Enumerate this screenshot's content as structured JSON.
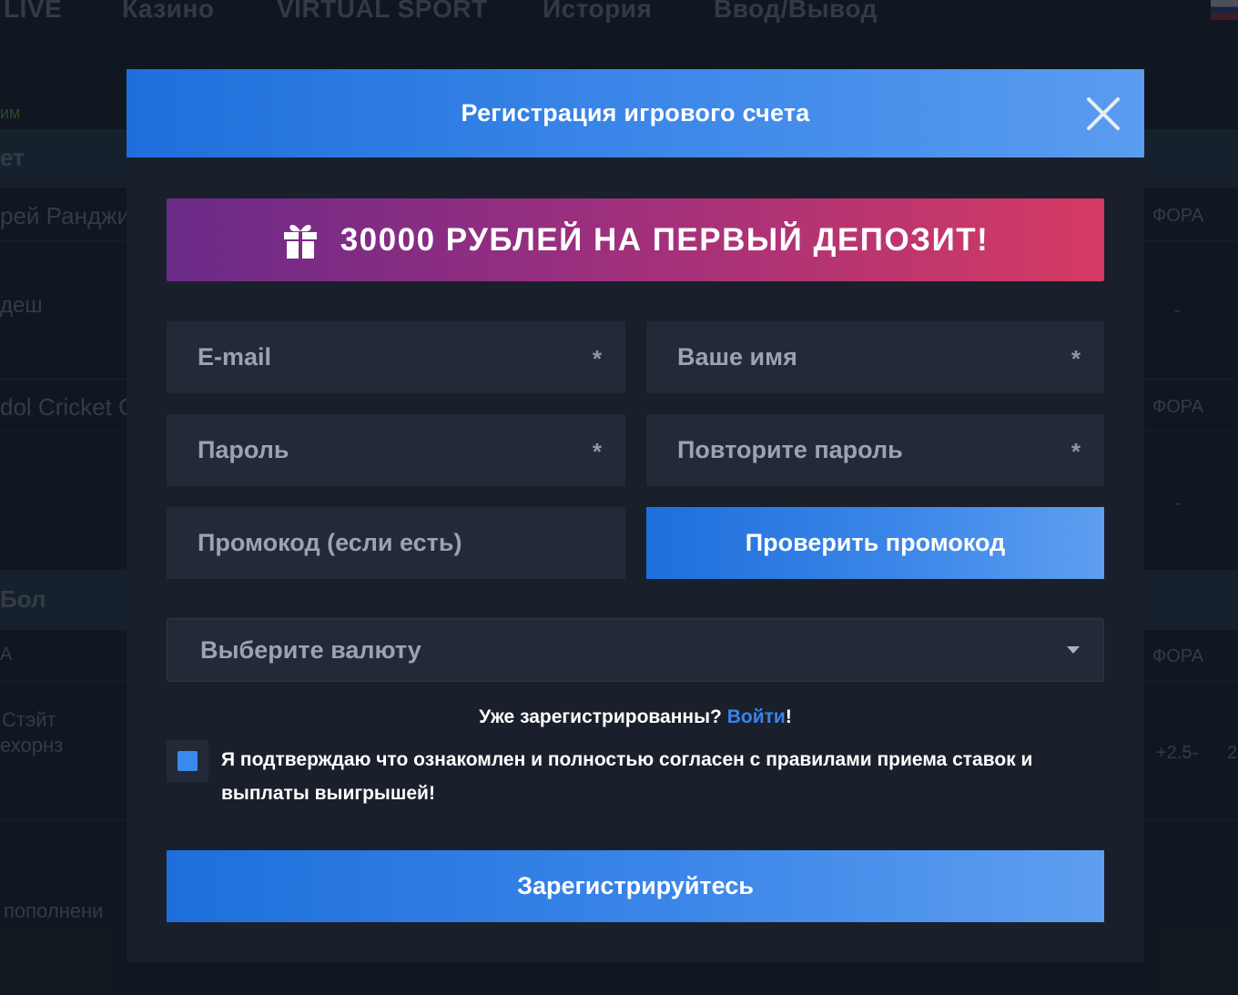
{
  "background": {
    "nav": [
      "LIVE",
      "Казино",
      "VIRTUAL SPORT",
      "История",
      "Ввод/Вывод"
    ],
    "left_texts": [
      "им",
      "ет",
      "рей Ранджи",
      "деш",
      "dol Cricket C",
      "Бол",
      "А",
      "Стэйт",
      "ехорнз",
      "пополнени"
    ],
    "right_texts": [
      "ФОРА",
      "-",
      "ФОРА",
      "-",
      "ФОРА",
      "+2.5-",
      "2"
    ]
  },
  "modal": {
    "title": "Регистрация игрового счета",
    "promo": "30000 РУБЛЕЙ НА ПЕРВЫЙ ДЕПОЗИТ!",
    "fields": {
      "email": "E-mail",
      "name": "Ваше имя",
      "password": "Пароль",
      "password_repeat": "Повторите пароль",
      "promocode": "Промокод (если есть)",
      "required_mark": "*"
    },
    "check_promo_label": "Проверить промокод",
    "currency_placeholder": "Выберите валюту",
    "already_registered": "Уже зарегистрированны?",
    "login_link": "Войти",
    "exclaim": "!",
    "agree_text": "Я подтверждаю что ознакомлен и полностью согласен с правилами приема ставок и выплаты выигрышей!",
    "submit_label": "Зарегистрируйтесь"
  },
  "colors": {
    "accent": "#2f7de6",
    "promo_start": "#6a2a88",
    "promo_end": "#d53a63",
    "link": "#3b82f0"
  },
  "icons": {
    "close": "close-icon",
    "gift": "gift-icon",
    "caret": "chevron-down-icon"
  }
}
